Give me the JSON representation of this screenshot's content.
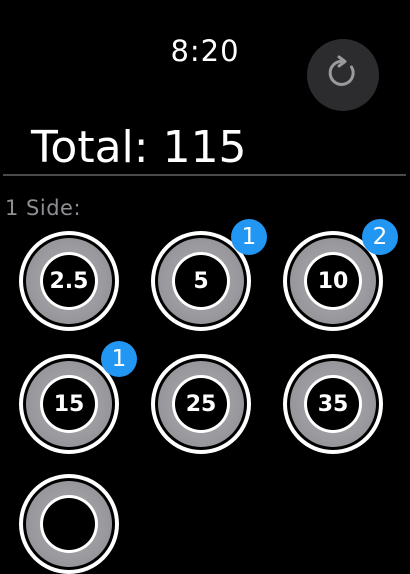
{
  "status_bar": {
    "time": "8:20"
  },
  "reset_button": {
    "icon": "refresh-icon"
  },
  "summary": {
    "total_text": "Total: 115"
  },
  "section": {
    "label": "1 Side:"
  },
  "plates": [
    {
      "value": "2.5",
      "count": null
    },
    {
      "value": "5",
      "count": "1"
    },
    {
      "value": "10",
      "count": "2"
    },
    {
      "value": "15",
      "count": "1"
    },
    {
      "value": "25",
      "count": null
    },
    {
      "value": "35",
      "count": null
    },
    {
      "value": "",
      "count": null
    }
  ],
  "colors": {
    "background": "#000000",
    "badge": "#2196f3",
    "plate_grey": "#9b9ba0",
    "reset_button_bg": "#2c2c2e",
    "section_label": "#8e8e93"
  }
}
